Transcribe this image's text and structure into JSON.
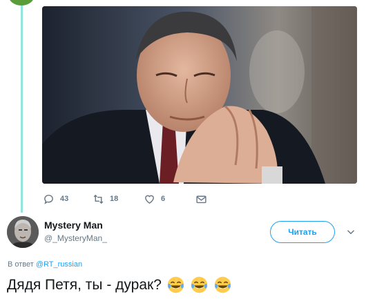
{
  "tweet": {
    "stats": {
      "replies": "43",
      "retweets": "18",
      "likes": "6"
    }
  },
  "reply": {
    "user": {
      "name": "Mystery Man",
      "handle": "@_MysteryMan_"
    },
    "follow_label": "Читать",
    "in_reply_to_prefix": "В ответ",
    "in_reply_to_mention": "@RT_russian",
    "text": "Дядя Петя, ты - дурак?",
    "emoji": [
      "face-with-tears-of-joy",
      "face-with-tears-of-joy",
      "face-with-tears-of-joy"
    ]
  },
  "colors": {
    "accent": "#1da1f2",
    "thread_line": "#90e6de",
    "muted": "#657786"
  }
}
